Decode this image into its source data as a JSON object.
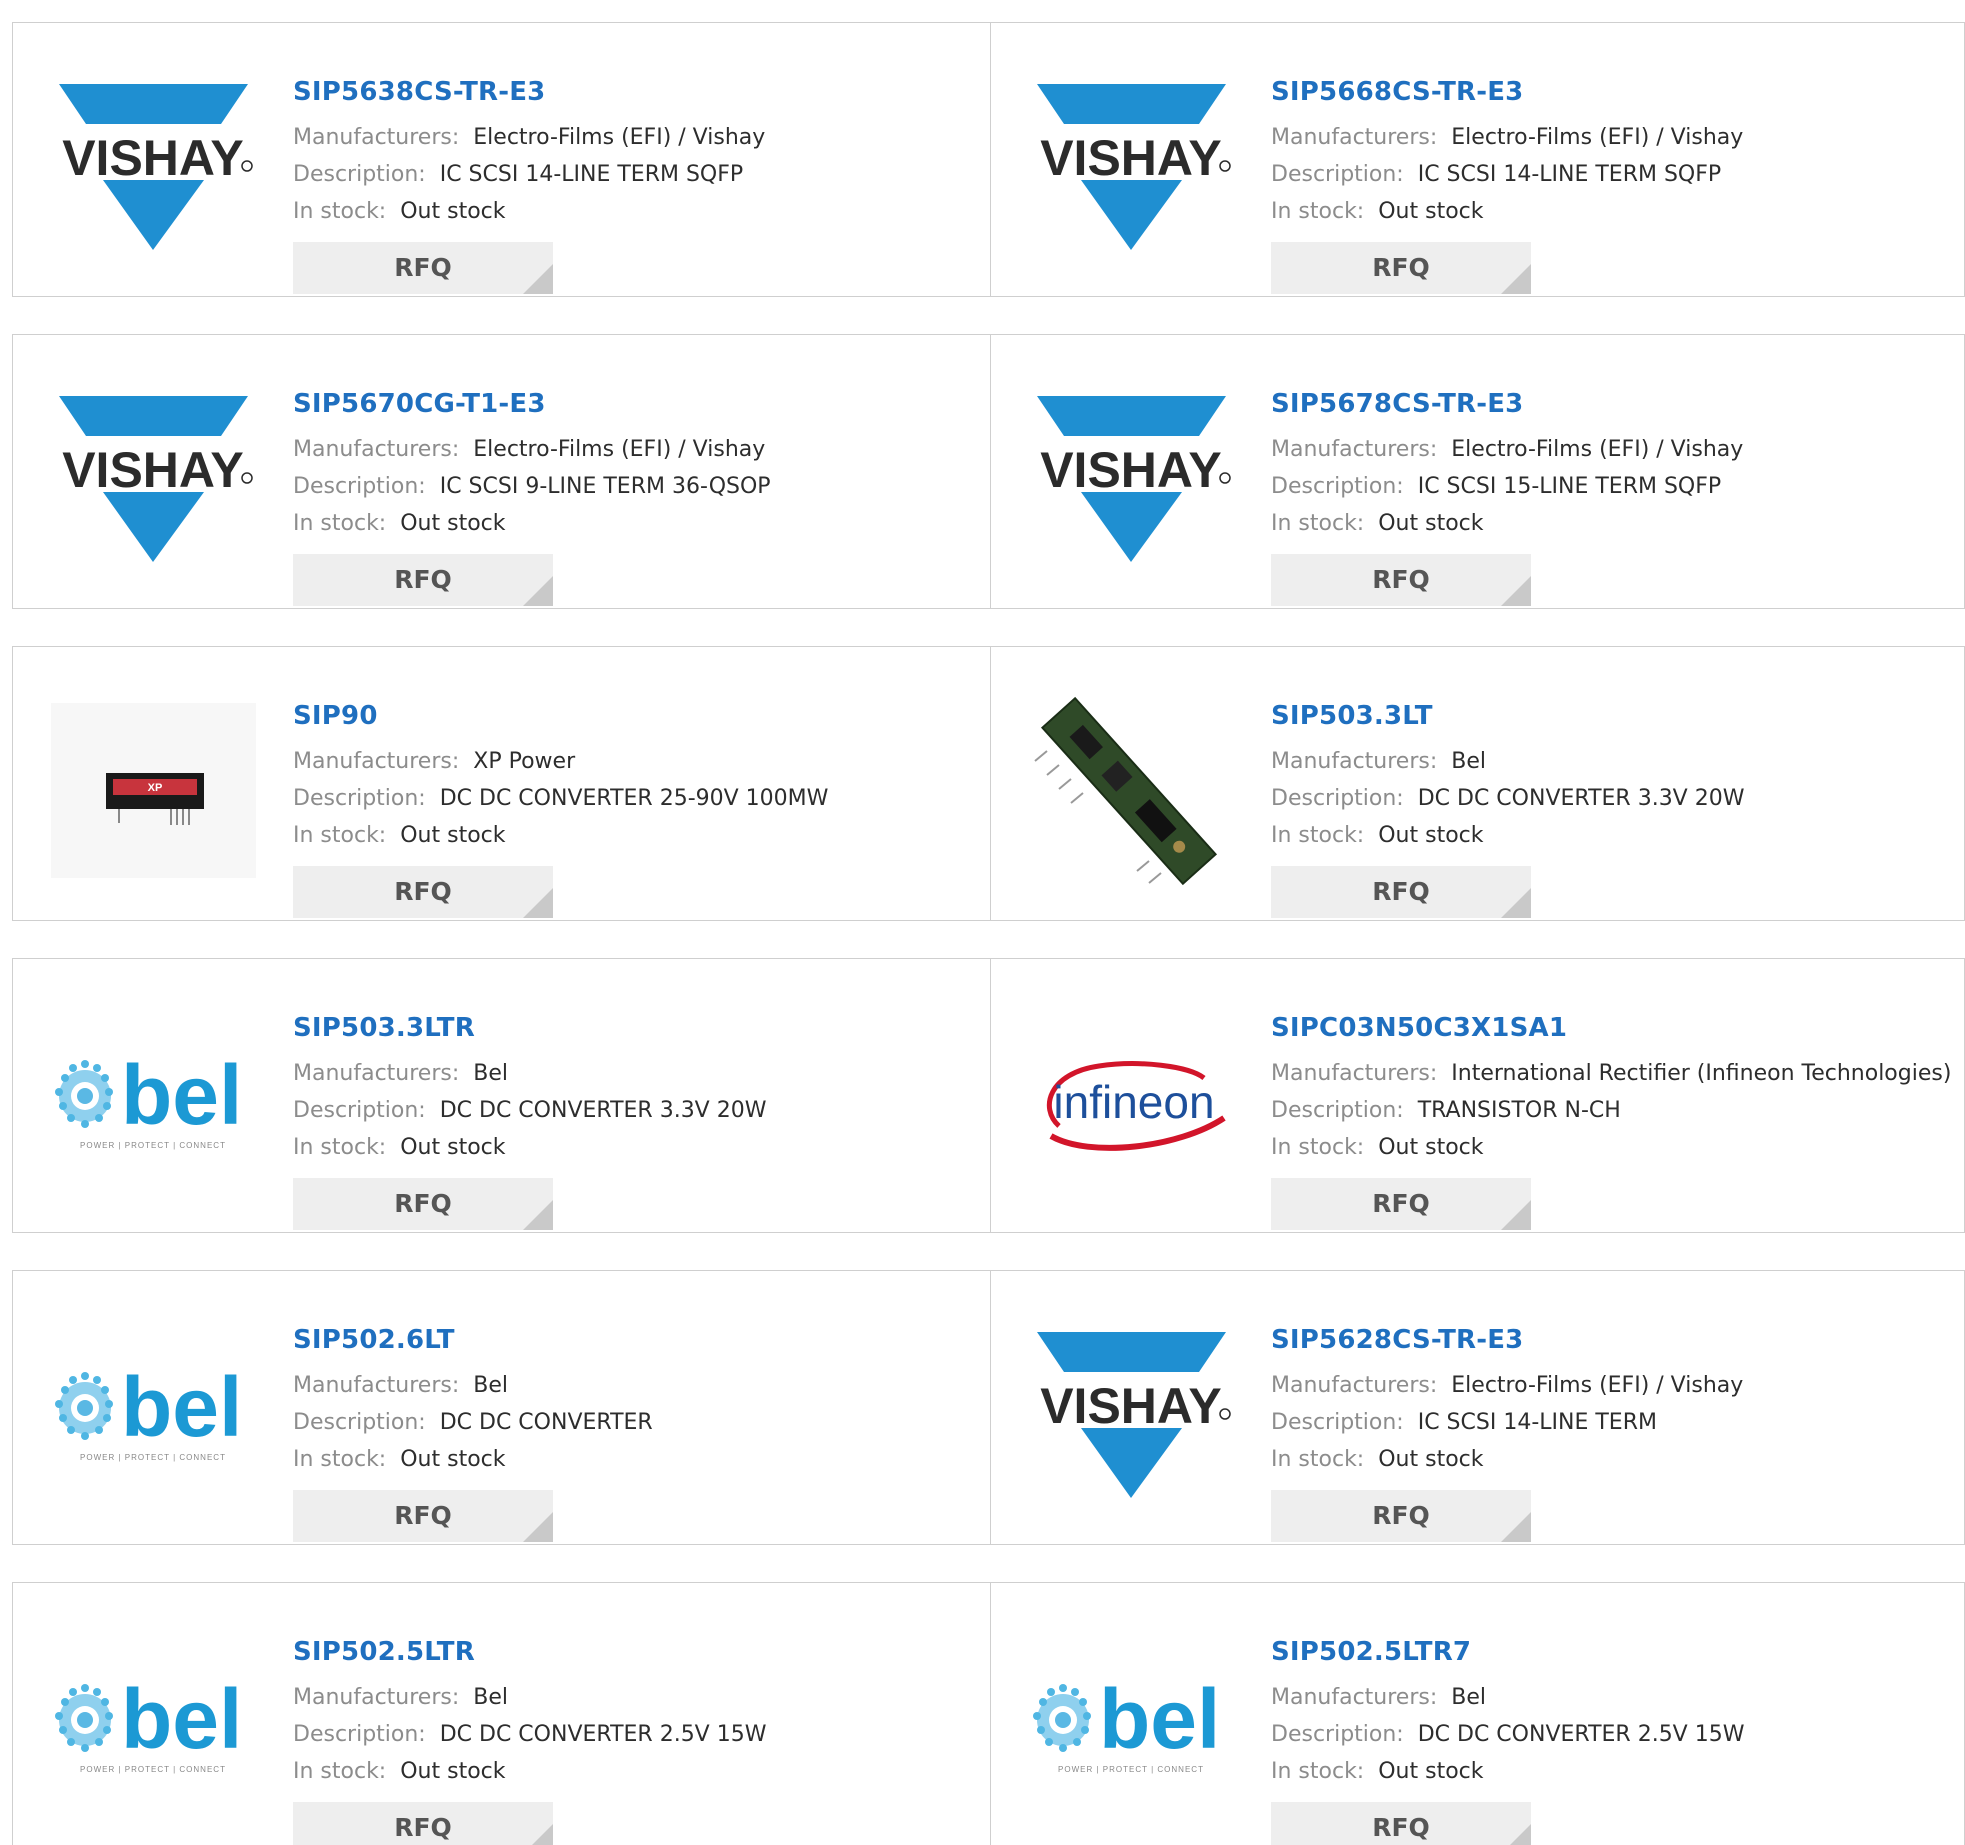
{
  "labels": {
    "manufacturers": "Manufacturers:",
    "description": "Description:",
    "in_stock": "In stock:",
    "rfq": "RFQ"
  },
  "brands": {
    "vishay": "VISHAY",
    "bel": "bel",
    "bel_tagline": "POWER | PROTECT | CONNECT",
    "infineon": "infineon",
    "product_marking": "XP"
  },
  "colors": {
    "link": "#1f6fbf",
    "vishay_blue": "#1f8fd1",
    "bel_blue": "#1c99d4",
    "infineon_red": "#d2152a"
  },
  "products": [
    {
      "part": "SIP5638CS-TR-E3",
      "manufacturer": "Electro-Films (EFI) / Vishay",
      "description": "IC SCSI 14-LINE TERM SQFP",
      "stock": "Out stock",
      "logo": "vishay-logo"
    },
    {
      "part": "SIP5668CS-TR-E3",
      "manufacturer": "Electro-Films (EFI) / Vishay",
      "description": "IC SCSI 14-LINE TERM SQFP",
      "stock": "Out stock",
      "logo": "vishay-logo"
    },
    {
      "part": "SIP5670CG-T1-E3",
      "manufacturer": "Electro-Films (EFI) / Vishay",
      "description": "IC SCSI 9-LINE TERM 36-QSOP",
      "stock": "Out stock",
      "logo": "vishay-logo"
    },
    {
      "part": "SIP5678CS-TR-E3",
      "manufacturer": "Electro-Films (EFI) / Vishay",
      "description": "IC SCSI 15-LINE TERM SQFP",
      "stock": "Out stock",
      "logo": "vishay-logo"
    },
    {
      "part": "SIP90",
      "manufacturer": "XP Power",
      "description": "DC DC CONVERTER 25-90V 100MW",
      "stock": "Out stock",
      "logo": "converter-photo"
    },
    {
      "part": "SIP503.3LT",
      "manufacturer": "Bel",
      "description": "DC DC CONVERTER 3.3V 20W",
      "stock": "Out stock",
      "logo": "pcb-module-photo"
    },
    {
      "part": "SIP503.3LTR",
      "manufacturer": "Bel",
      "description": "DC DC CONVERTER 3.3V 20W",
      "stock": "Out stock",
      "logo": "bel-logo"
    },
    {
      "part": "SIPC03N50C3X1SA1",
      "manufacturer": "International Rectifier (Infineon Technologies)",
      "description": "TRANSISTOR N-CH",
      "stock": "Out stock",
      "logo": "infineon-logo"
    },
    {
      "part": "SIP502.6LT",
      "manufacturer": "Bel",
      "description": "DC DC CONVERTER",
      "stock": "Out stock",
      "logo": "bel-logo"
    },
    {
      "part": "SIP5628CS-TR-E3",
      "manufacturer": "Electro-Films (EFI) / Vishay",
      "description": "IC SCSI 14-LINE TERM",
      "stock": "Out stock",
      "logo": "vishay-logo"
    },
    {
      "part": "SIP502.5LTR",
      "manufacturer": "Bel",
      "description": "DC DC CONVERTER 2.5V 15W",
      "stock": "Out stock",
      "logo": "bel-logo"
    },
    {
      "part": "SIP502.5LTR7",
      "manufacturer": "Bel",
      "description": "DC DC CONVERTER 2.5V 15W",
      "stock": "Out stock",
      "logo": "bel-logo"
    }
  ]
}
